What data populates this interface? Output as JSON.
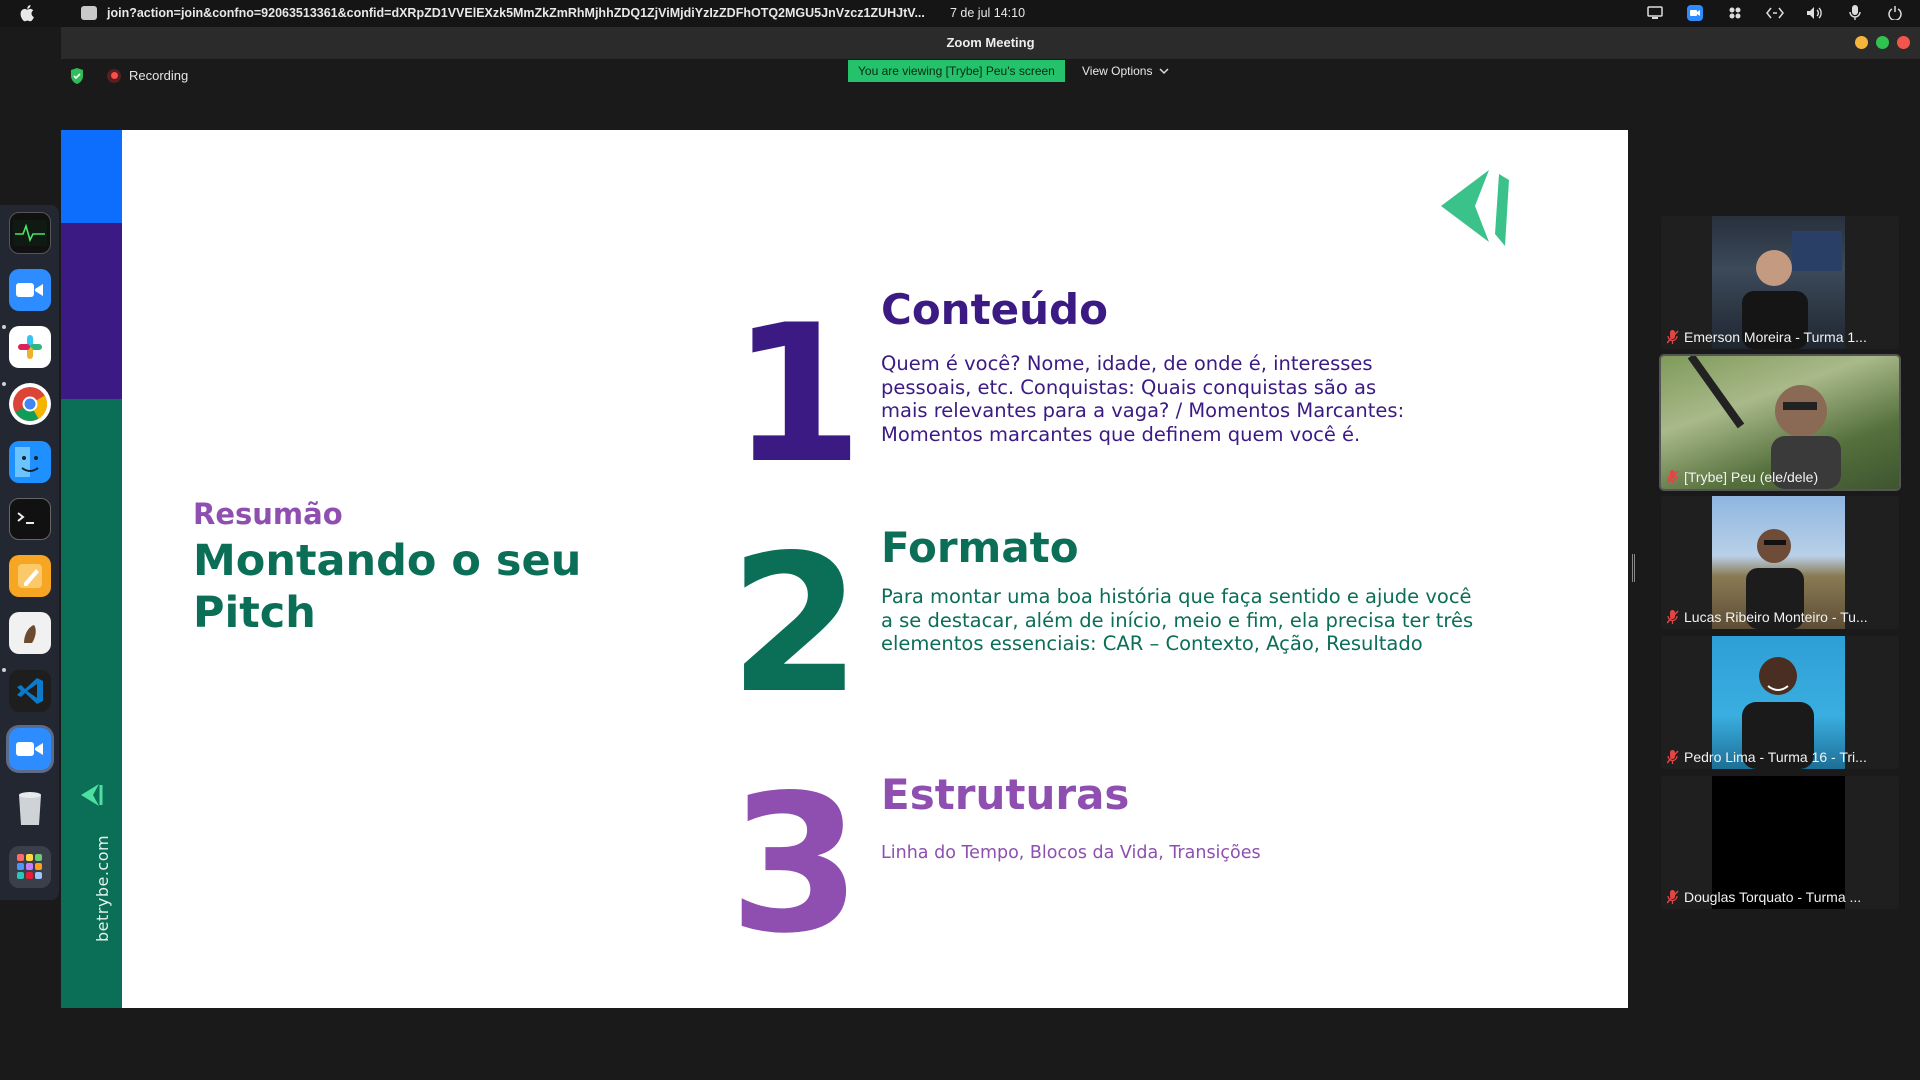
{
  "menubar": {
    "url": "join?action=join&confno=92063513361&confid=dXRpZD1VVElEXzk5MmZkZmRhMjhhZDQ1ZjViMjdiYzIzZDFhOTQ2MGU5JnVzcz1ZUHJtV...",
    "clock": "7 de jul  14:10"
  },
  "window": {
    "title": "Zoom Meeting"
  },
  "topbar": {
    "recording": "Recording",
    "viewing": "You are viewing [Trybe] Peu's screen",
    "view_options": "View Options"
  },
  "slide": {
    "subtitle": "Resumão",
    "title": "Montando o seu Pitch",
    "site": "betrybe.com",
    "sections": [
      {
        "number": "1",
        "title": "Conteúdo",
        "body": "Quem é você? Nome, idade, de onde é, interesses pessoais, etc. Conquistas: Quais conquistas são as mais relevantes para a vaga? / Momentos Marcantes: Momentos marcantes que definem quem você é."
      },
      {
        "number": "2",
        "title": "Formato",
        "body": "Para montar uma boa história que faça sentido e ajude você a se destacar, além de início, meio e fim, ela precisa ter três elementos essenciais: CAR – Contexto, Ação, Resultado"
      },
      {
        "number": "3",
        "title": "Estruturas",
        "body": "Linha do Tempo, Blocos da Vida, Transições"
      }
    ],
    "colors": {
      "purple": "#3b1a84",
      "green": "#0b6e57",
      "lilac": "#8e4fb0",
      "blue": "#0d6efd"
    }
  },
  "participants": [
    {
      "name": "Emerson Moreira - Turma 1...",
      "muted": true
    },
    {
      "name": "[Trybe] Peu (ele/dele)",
      "muted": true
    },
    {
      "name": "Lucas Ribeiro Monteiro - Tu...",
      "muted": true
    },
    {
      "name": "Pedro Lima - Turma 16 - Tri...",
      "muted": true
    },
    {
      "name": "Douglas Torquato - Turma ...",
      "muted": true
    }
  ],
  "dock_apps": [
    "activity-monitor-icon",
    "zoom-icon",
    "slack-icon",
    "chrome-icon",
    "finder-icon",
    "terminal-icon",
    "pages-icon",
    "app-icon",
    "vscode-icon",
    "zoom-active-icon",
    "trash-icon",
    "launchpad-icon"
  ]
}
